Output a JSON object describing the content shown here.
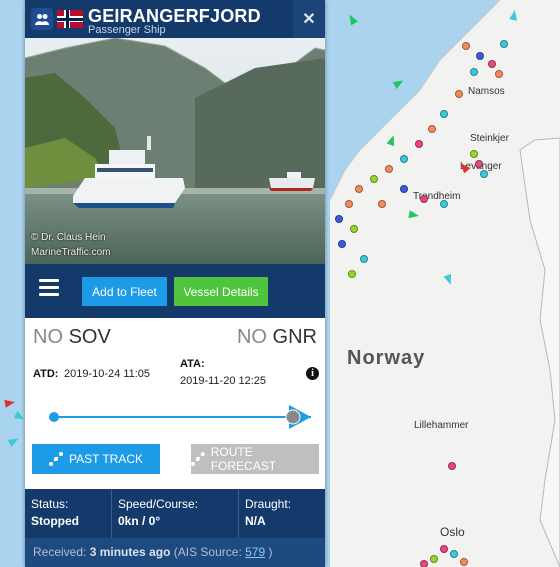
{
  "vessel": {
    "name": "GEIRANGERFJORD",
    "type": "Passenger Ship"
  },
  "photo": {
    "credit": "© Dr. Claus Hein",
    "watermark": "MarineTraffic.com"
  },
  "actions": {
    "add_to_fleet": "Add to Fleet",
    "vessel_details": "Vessel Details"
  },
  "route": {
    "from_cc": "NO",
    "from_port": "SOV",
    "to_cc": "NO",
    "to_port": "GNR",
    "atd_label": "ATD:",
    "atd_value": "2019-10-24 11:05",
    "ata_label": "ATA:",
    "ata_value": "2019-11-20 12:25",
    "progress": 0.93
  },
  "track": {
    "past_track": "PAST TRACK",
    "route_forecast": "ROUTE FORECAST"
  },
  "status": {
    "status_label": "Status:",
    "status_value": "Stopped",
    "speed_label": "Speed/Course:",
    "speed_value": "0kn / 0°",
    "draught_label": "Draught:",
    "draught_value": "N/A"
  },
  "received": {
    "prefix": "Received:",
    "age": "3 minutes ago",
    "source_prefix": "(AIS Source:",
    "source_id": "579",
    "source_suffix": ")"
  },
  "map": {
    "country": "Norway",
    "cities": [
      "Namsos",
      "Steinkjer",
      "Levanger",
      "Trondheim",
      "Lillehammer",
      "Oslo"
    ]
  },
  "colors": {
    "header": "#143a6c",
    "fleet_button": "#1e9be6",
    "details_button": "#4fc43c",
    "forecast_button": "#bfbfbf"
  }
}
